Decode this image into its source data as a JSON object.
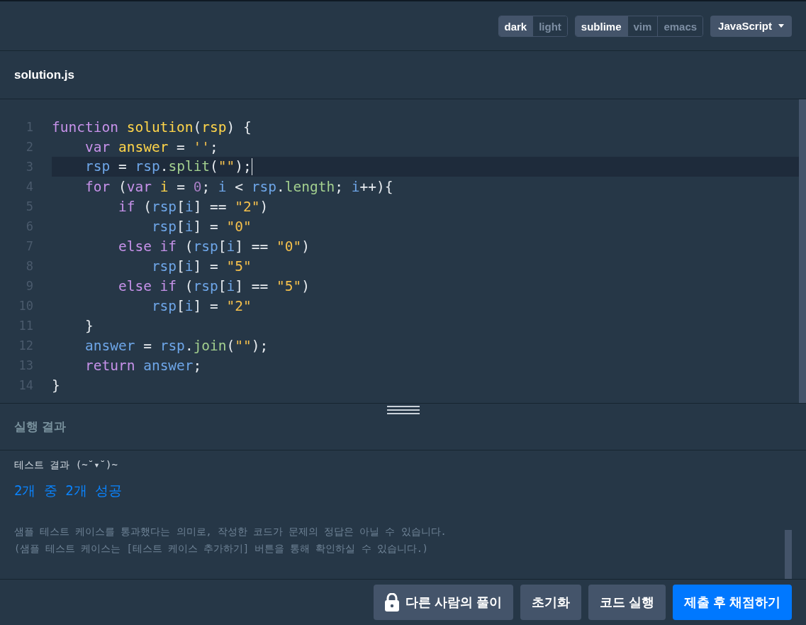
{
  "toolbar": {
    "theme_toggle": [
      {
        "label": "dark",
        "selected": true
      },
      {
        "label": "light",
        "selected": false
      }
    ],
    "keymap_toggle": [
      {
        "label": "sublime",
        "selected": true
      },
      {
        "label": "vim",
        "selected": false
      },
      {
        "label": "emacs",
        "selected": false
      }
    ],
    "language_dropdown": {
      "value": "JavaScript"
    }
  },
  "file_tab": {
    "label": "solution.js"
  },
  "editor": {
    "lines": [
      {
        "number": "1",
        "selected": false,
        "tokens": [
          {
            "t": "function",
            "color": "#c792ea"
          },
          {
            "t": " solution",
            "color": "#ffd54a"
          },
          {
            "t": "(",
            "color": "#e8ecf0"
          },
          {
            "t": "rsp",
            "color": "#ffd54a"
          },
          {
            "t": ") {",
            "color": "#e8ecf0"
          }
        ]
      },
      {
        "number": "2",
        "selected": false,
        "tokens": [
          {
            "t": "    var",
            "color": "#c792ea"
          },
          {
            "t": " answer",
            "color": "#ffd54a"
          },
          {
            "t": " = ",
            "color": "#e8ecf0"
          },
          {
            "t": "''",
            "color": "#f4c04d"
          },
          {
            "t": ";",
            "color": "#e8ecf0"
          }
        ]
      },
      {
        "number": "3",
        "selected": true,
        "tokens": [
          {
            "t": "    rsp",
            "color": "#6ea6e8"
          },
          {
            "t": " = ",
            "color": "#e8ecf0"
          },
          {
            "t": "rsp",
            "color": "#6ea6e8"
          },
          {
            "t": ".",
            "color": "#e8ecf0"
          },
          {
            "t": "split",
            "color": "#a3d08f"
          },
          {
            "t": "(",
            "color": "#e8ecf0"
          },
          {
            "t": "\"\"",
            "color": "#f4c04d"
          },
          {
            "t": ");",
            "color": "#e8ecf0"
          }
        ]
      },
      {
        "number": "4",
        "selected": false,
        "tokens": [
          {
            "t": "    for",
            "color": "#c792ea"
          },
          {
            "t": " (",
            "color": "#e8ecf0"
          },
          {
            "t": "var",
            "color": "#c792ea"
          },
          {
            "t": " i",
            "color": "#ffd54a"
          },
          {
            "t": " = ",
            "color": "#e8ecf0"
          },
          {
            "t": "0",
            "color": "#a87fc4"
          },
          {
            "t": "; ",
            "color": "#e8ecf0"
          },
          {
            "t": "i",
            "color": "#6ea6e8"
          },
          {
            "t": " < ",
            "color": "#e8ecf0"
          },
          {
            "t": "rsp",
            "color": "#6ea6e8"
          },
          {
            "t": ".",
            "color": "#e8ecf0"
          },
          {
            "t": "length",
            "color": "#a3d08f"
          },
          {
            "t": "; ",
            "color": "#e8ecf0"
          },
          {
            "t": "i",
            "color": "#6ea6e8"
          },
          {
            "t": "++){",
            "color": "#e8ecf0"
          }
        ]
      },
      {
        "number": "5",
        "selected": false,
        "tokens": [
          {
            "t": "        if",
            "color": "#c792ea"
          },
          {
            "t": " (",
            "color": "#e8ecf0"
          },
          {
            "t": "rsp",
            "color": "#6ea6e8"
          },
          {
            "t": "[",
            "color": "#e8ecf0"
          },
          {
            "t": "i",
            "color": "#6ea6e8"
          },
          {
            "t": "] == ",
            "color": "#e8ecf0"
          },
          {
            "t": "\"2\"",
            "color": "#f4c04d"
          },
          {
            "t": ")",
            "color": "#e8ecf0"
          }
        ]
      },
      {
        "number": "6",
        "selected": false,
        "tokens": [
          {
            "t": "            rsp",
            "color": "#6ea6e8"
          },
          {
            "t": "[",
            "color": "#e8ecf0"
          },
          {
            "t": "i",
            "color": "#6ea6e8"
          },
          {
            "t": "] = ",
            "color": "#e8ecf0"
          },
          {
            "t": "\"0\"",
            "color": "#f4c04d"
          }
        ]
      },
      {
        "number": "7",
        "selected": false,
        "tokens": [
          {
            "t": "        else if",
            "color": "#c792ea"
          },
          {
            "t": " (",
            "color": "#e8ecf0"
          },
          {
            "t": "rsp",
            "color": "#6ea6e8"
          },
          {
            "t": "[",
            "color": "#e8ecf0"
          },
          {
            "t": "i",
            "color": "#6ea6e8"
          },
          {
            "t": "] == ",
            "color": "#e8ecf0"
          },
          {
            "t": "\"0\"",
            "color": "#f4c04d"
          },
          {
            "t": ")",
            "color": "#e8ecf0"
          }
        ]
      },
      {
        "number": "8",
        "selected": false,
        "tokens": [
          {
            "t": "            rsp",
            "color": "#6ea6e8"
          },
          {
            "t": "[",
            "color": "#e8ecf0"
          },
          {
            "t": "i",
            "color": "#6ea6e8"
          },
          {
            "t": "] = ",
            "color": "#e8ecf0"
          },
          {
            "t": "\"5\"",
            "color": "#f4c04d"
          }
        ]
      },
      {
        "number": "9",
        "selected": false,
        "tokens": [
          {
            "t": "        else if",
            "color": "#c792ea"
          },
          {
            "t": " (",
            "color": "#e8ecf0"
          },
          {
            "t": "rsp",
            "color": "#6ea6e8"
          },
          {
            "t": "[",
            "color": "#e8ecf0"
          },
          {
            "t": "i",
            "color": "#6ea6e8"
          },
          {
            "t": "] == ",
            "color": "#e8ecf0"
          },
          {
            "t": "\"5\"",
            "color": "#f4c04d"
          },
          {
            "t": ")",
            "color": "#e8ecf0"
          }
        ]
      },
      {
        "number": "10",
        "selected": false,
        "tokens": [
          {
            "t": "            rsp",
            "color": "#6ea6e8"
          },
          {
            "t": "[",
            "color": "#e8ecf0"
          },
          {
            "t": "i",
            "color": "#6ea6e8"
          },
          {
            "t": "] = ",
            "color": "#e8ecf0"
          },
          {
            "t": "\"2\"",
            "color": "#f4c04d"
          }
        ]
      },
      {
        "number": "11",
        "selected": false,
        "tokens": [
          {
            "t": "    }",
            "color": "#e8ecf0"
          }
        ]
      },
      {
        "number": "12",
        "selected": false,
        "tokens": [
          {
            "t": "    answer",
            "color": "#6ea6e8"
          },
          {
            "t": " = ",
            "color": "#e8ecf0"
          },
          {
            "t": "rsp",
            "color": "#6ea6e8"
          },
          {
            "t": ".",
            "color": "#e8ecf0"
          },
          {
            "t": "join",
            "color": "#a3d08f"
          },
          {
            "t": "(",
            "color": "#e8ecf0"
          },
          {
            "t": "\"\"",
            "color": "#f4c04d"
          },
          {
            "t": ");",
            "color": "#e8ecf0"
          }
        ]
      },
      {
        "number": "13",
        "selected": false,
        "tokens": [
          {
            "t": "    return",
            "color": "#c792ea"
          },
          {
            "t": " answer",
            "color": "#6ea6e8"
          },
          {
            "t": ";",
            "color": "#e8ecf0"
          }
        ]
      },
      {
        "number": "14",
        "selected": false,
        "tokens": [
          {
            "t": "}",
            "color": "#e8ecf0"
          }
        ]
      }
    ]
  },
  "result_panel": {
    "title": "실행 결과",
    "heading": "테스트 결과 (~˘▾˘)~",
    "summary": "2개 중 2개 성공",
    "notes": [
      "샘플 테스트 케이스를 통과했다는 의미로, 작성한 코드가 문제의 정답은 아닐 수 있습니다.",
      "(샘플 테스트 케이스는 [테스트 케이스 추가하기] 버튼을 통해 확인하실 수 있습니다.)"
    ]
  },
  "buttons": [
    {
      "label": "다른 사람의 풀이",
      "kind": "locked"
    },
    {
      "label": "초기화",
      "kind": "secondary"
    },
    {
      "label": "코드 실행",
      "kind": "secondary"
    },
    {
      "label": "제출 후 채점하기",
      "kind": "primary"
    }
  ]
}
